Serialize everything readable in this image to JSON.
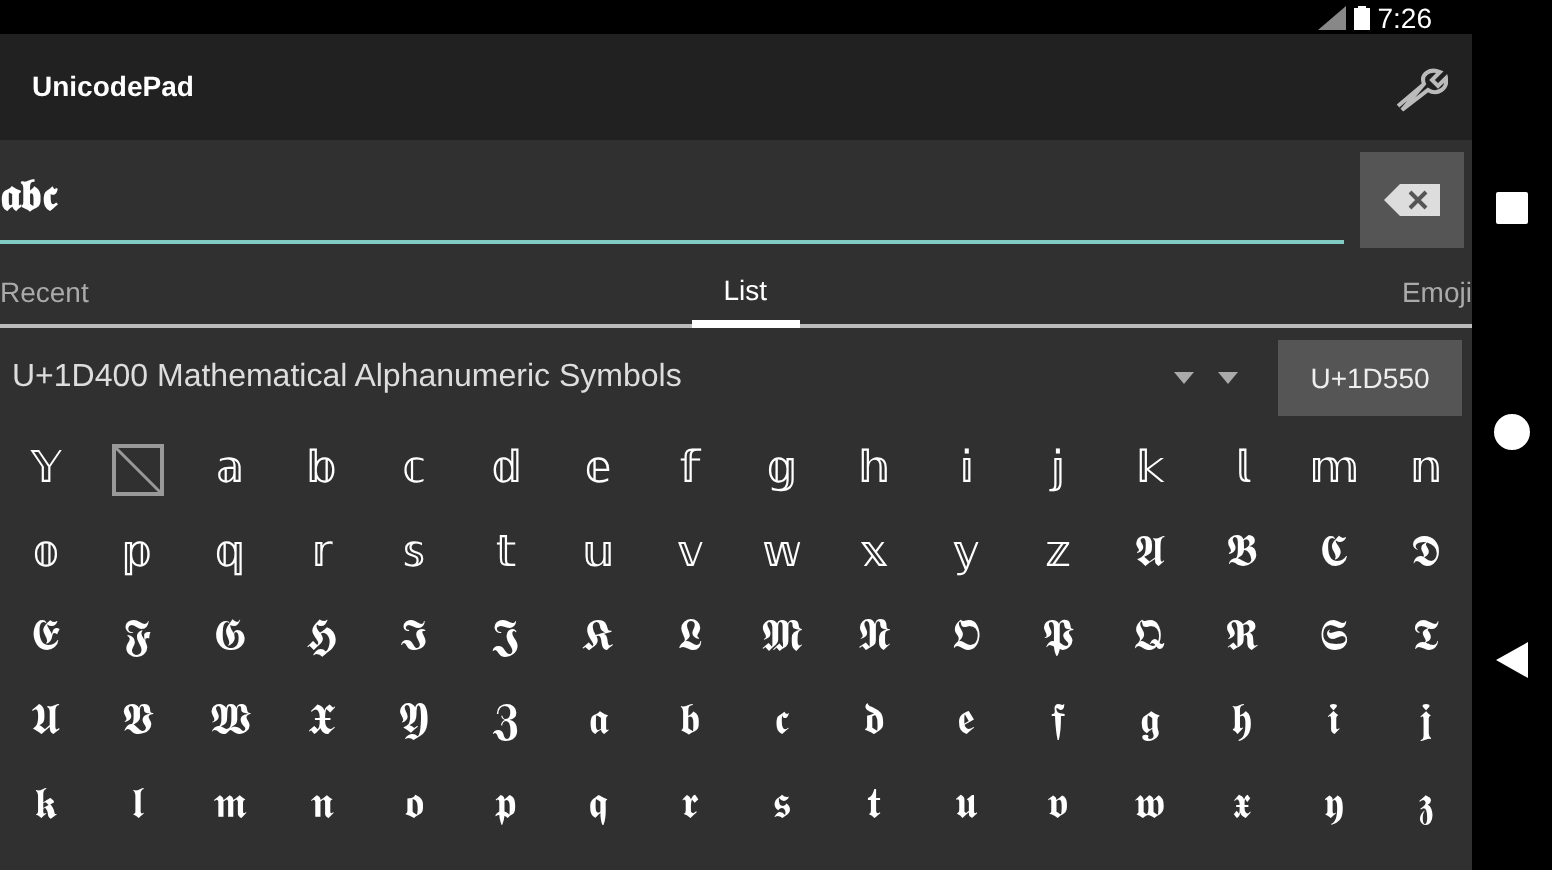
{
  "status_bar": {
    "time": "7:26"
  },
  "app_bar": {
    "title": "UnicodePad"
  },
  "input": {
    "value": "𝖆𝖇𝖈"
  },
  "tabs": [
    {
      "label": "Recent",
      "selected": false
    },
    {
      "label": "List",
      "selected": true
    },
    {
      "label": "Emoji",
      "selected": false
    }
  ],
  "block_selector": {
    "value": "U+1D400 Mathematical Alphanumeric Symbols",
    "jump_button": "U+1D550"
  },
  "grid": [
    {
      "cells": [
        {
          "kind": "char",
          "text": "𝕐"
        },
        {
          "kind": "missing"
        },
        {
          "kind": "char",
          "text": "𝕒"
        },
        {
          "kind": "char",
          "text": "𝕓"
        },
        {
          "kind": "char",
          "text": "𝕔"
        },
        {
          "kind": "char",
          "text": "𝕕"
        },
        {
          "kind": "char",
          "text": "𝕖"
        },
        {
          "kind": "char",
          "text": "𝕗"
        },
        {
          "kind": "char",
          "text": "𝕘"
        },
        {
          "kind": "char",
          "text": "𝕙"
        },
        {
          "kind": "char",
          "text": "𝕚"
        },
        {
          "kind": "char",
          "text": "𝕛"
        },
        {
          "kind": "char",
          "text": "𝕜"
        },
        {
          "kind": "char",
          "text": "𝕝"
        },
        {
          "kind": "char",
          "text": "𝕞"
        },
        {
          "kind": "char",
          "text": "𝕟"
        }
      ]
    },
    {
      "cells": [
        {
          "kind": "char",
          "text": "𝕠"
        },
        {
          "kind": "char",
          "text": "𝕡"
        },
        {
          "kind": "char",
          "text": "𝕢"
        },
        {
          "kind": "char",
          "text": "𝕣"
        },
        {
          "kind": "char",
          "text": "𝕤"
        },
        {
          "kind": "char",
          "text": "𝕥"
        },
        {
          "kind": "char",
          "text": "𝕦"
        },
        {
          "kind": "char",
          "text": "𝕧"
        },
        {
          "kind": "char",
          "text": "𝕨"
        },
        {
          "kind": "char",
          "text": "𝕩"
        },
        {
          "kind": "char",
          "text": "𝕪"
        },
        {
          "kind": "char",
          "text": "𝕫"
        },
        {
          "kind": "char",
          "text": "𝕬"
        },
        {
          "kind": "char",
          "text": "𝕭"
        },
        {
          "kind": "char",
          "text": "𝕮"
        },
        {
          "kind": "char",
          "text": "𝕯"
        }
      ]
    },
    {
      "cells": [
        {
          "kind": "char",
          "text": "𝕰"
        },
        {
          "kind": "char",
          "text": "𝕱"
        },
        {
          "kind": "char",
          "text": "𝕲"
        },
        {
          "kind": "char",
          "text": "𝕳"
        },
        {
          "kind": "char",
          "text": "𝕴"
        },
        {
          "kind": "char",
          "text": "𝕵"
        },
        {
          "kind": "char",
          "text": "𝕶"
        },
        {
          "kind": "char",
          "text": "𝕷"
        },
        {
          "kind": "char",
          "text": "𝕸"
        },
        {
          "kind": "char",
          "text": "𝕹"
        },
        {
          "kind": "char",
          "text": "𝕺"
        },
        {
          "kind": "char",
          "text": "𝕻"
        },
        {
          "kind": "char",
          "text": "𝕼"
        },
        {
          "kind": "char",
          "text": "𝕽"
        },
        {
          "kind": "char",
          "text": "𝕾"
        },
        {
          "kind": "char",
          "text": "𝕿"
        }
      ]
    },
    {
      "cells": [
        {
          "kind": "char",
          "text": "𝖀"
        },
        {
          "kind": "char",
          "text": "𝖁"
        },
        {
          "kind": "char",
          "text": "𝖂"
        },
        {
          "kind": "char",
          "text": "𝖃"
        },
        {
          "kind": "char",
          "text": "𝖄"
        },
        {
          "kind": "char",
          "text": "𝖅"
        },
        {
          "kind": "char",
          "text": "𝖆"
        },
        {
          "kind": "char",
          "text": "𝖇"
        },
        {
          "kind": "char",
          "text": "𝖈"
        },
        {
          "kind": "char",
          "text": "𝖉"
        },
        {
          "kind": "char",
          "text": "𝖊"
        },
        {
          "kind": "char",
          "text": "𝖋"
        },
        {
          "kind": "char",
          "text": "𝖌"
        },
        {
          "kind": "char",
          "text": "𝖍"
        },
        {
          "kind": "char",
          "text": "𝖎"
        },
        {
          "kind": "char",
          "text": "𝖏"
        }
      ]
    },
    {
      "cells": [
        {
          "kind": "char",
          "text": "𝖐"
        },
        {
          "kind": "char",
          "text": "𝖑"
        },
        {
          "kind": "char",
          "text": "𝖒"
        },
        {
          "kind": "char",
          "text": "𝖓"
        },
        {
          "kind": "char",
          "text": "𝖔"
        },
        {
          "kind": "char",
          "text": "𝖕"
        },
        {
          "kind": "char",
          "text": "𝖖"
        },
        {
          "kind": "char",
          "text": "𝖗"
        },
        {
          "kind": "char",
          "text": "𝖘"
        },
        {
          "kind": "char",
          "text": "𝖙"
        },
        {
          "kind": "char",
          "text": "𝖚"
        },
        {
          "kind": "char",
          "text": "𝖛"
        },
        {
          "kind": "char",
          "text": "𝖜"
        },
        {
          "kind": "char",
          "text": "𝖝"
        },
        {
          "kind": "char",
          "text": "𝖞"
        },
        {
          "kind": "char",
          "text": "𝖟"
        }
      ]
    }
  ]
}
